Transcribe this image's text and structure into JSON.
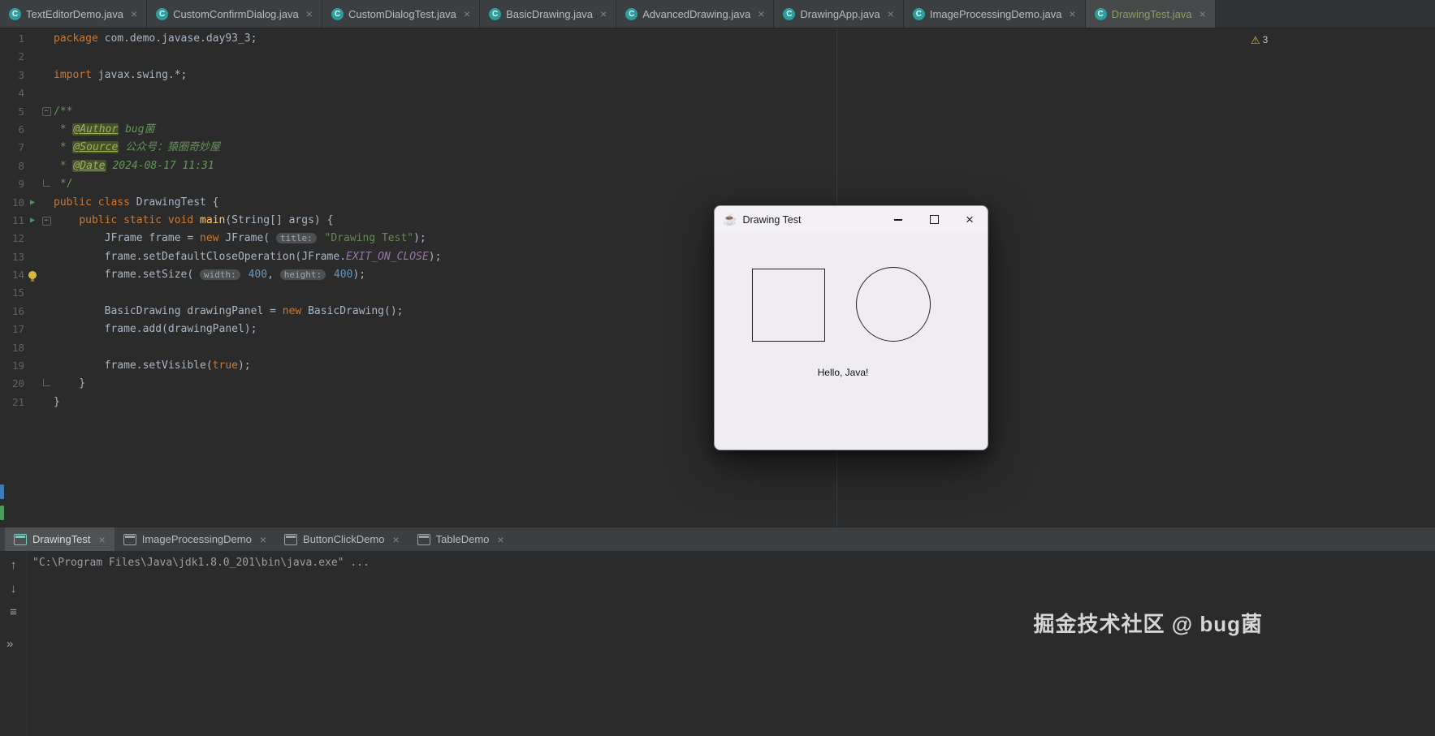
{
  "editor_tabs": {
    "icon_glyph": "C",
    "close_glyph": "×",
    "items": [
      {
        "label": "TextEditorDemo.java",
        "active": false
      },
      {
        "label": "CustomConfirmDialog.java",
        "active": false
      },
      {
        "label": "CustomDialogTest.java",
        "active": false
      },
      {
        "label": "BasicDrawing.java",
        "active": false
      },
      {
        "label": "AdvancedDrawing.java",
        "active": false
      },
      {
        "label": "DrawingApp.java",
        "active": false
      },
      {
        "label": "ImageProcessingDemo.java",
        "active": false
      },
      {
        "label": "DrawingTest.java",
        "active": true,
        "vcs": "new"
      }
    ]
  },
  "inspections": {
    "icon_glyph": "⚠",
    "count": "3"
  },
  "editor": {
    "run_glyph": "▶",
    "lines": [
      {
        "n": 1,
        "toks": [
          [
            "k",
            "package "
          ],
          [
            "p",
            "com.demo.javase.day93_3;"
          ]
        ]
      },
      {
        "n": 2,
        "toks": []
      },
      {
        "n": 3,
        "toks": [
          [
            "k",
            "import "
          ],
          [
            "p",
            "javax.swing.*;"
          ]
        ]
      },
      {
        "n": 4,
        "toks": []
      },
      {
        "n": 5,
        "fold": "open",
        "toks": [
          [
            "c",
            "/**"
          ]
        ]
      },
      {
        "n": 6,
        "toks": [
          [
            "c",
            " * "
          ],
          [
            "ct",
            "@Author"
          ],
          [
            "ci",
            " bug菌"
          ]
        ]
      },
      {
        "n": 7,
        "toks": [
          [
            "c",
            " * "
          ],
          [
            "ct",
            "@Source"
          ],
          [
            "ci",
            " 公众号：猿圈奇妙屋"
          ]
        ]
      },
      {
        "n": 8,
        "toks": [
          [
            "c",
            " * "
          ],
          [
            "ct",
            "@Date"
          ],
          [
            "ci",
            " 2024-08-17 11:31"
          ]
        ]
      },
      {
        "n": 9,
        "fold": "end",
        "toks": [
          [
            "c",
            " */"
          ]
        ]
      },
      {
        "n": 10,
        "icon": "run",
        "toks": [
          [
            "k",
            "public class "
          ],
          [
            "p",
            "DrawingTest {"
          ]
        ]
      },
      {
        "n": 11,
        "icon": "run",
        "fold": "open",
        "toks": [
          [
            "p",
            "    "
          ],
          [
            "k",
            "public static void "
          ],
          [
            "m",
            "main"
          ],
          [
            "p",
            "(String[] args) {"
          ]
        ]
      },
      {
        "n": 12,
        "toks": [
          [
            "p",
            "        JFrame frame = "
          ],
          [
            "k",
            "new "
          ],
          [
            "p",
            "JFrame( "
          ],
          [
            "hint",
            "title:"
          ],
          [
            "s",
            " \"Drawing Test\""
          ],
          [
            "p",
            ");"
          ]
        ]
      },
      {
        "n": 13,
        "toks": [
          [
            "p",
            "        frame.setDefaultCloseOperation(JFrame."
          ],
          [
            "const",
            "EXIT_ON_CLOSE"
          ],
          [
            "p",
            ");"
          ]
        ]
      },
      {
        "n": 14,
        "icon": "bulb",
        "toks": [
          [
            "p",
            "        frame.setSize( "
          ],
          [
            "hint",
            "width:"
          ],
          [
            "num",
            " 400"
          ],
          [
            "p",
            ", "
          ],
          [
            "hint",
            "height:"
          ],
          [
            "num",
            " 400"
          ],
          [
            "p",
            ");"
          ]
        ]
      },
      {
        "n": 15,
        "toks": []
      },
      {
        "n": 16,
        "toks": [
          [
            "p",
            "        BasicDrawing drawingPanel = "
          ],
          [
            "k",
            "new "
          ],
          [
            "p",
            "BasicDrawing();"
          ]
        ]
      },
      {
        "n": 17,
        "toks": [
          [
            "p",
            "        frame.add(drawingPanel);"
          ]
        ]
      },
      {
        "n": 18,
        "toks": []
      },
      {
        "n": 19,
        "toks": [
          [
            "p",
            "        frame.setVisible("
          ],
          [
            "k",
            "true"
          ],
          [
            "p",
            ");"
          ]
        ]
      },
      {
        "n": 20,
        "fold": "end",
        "toks": [
          [
            "p",
            "    }"
          ]
        ]
      },
      {
        "n": 21,
        "toks": [
          [
            "p",
            "}"
          ]
        ]
      }
    ]
  },
  "run_tabs": {
    "items": [
      {
        "label": "DrawingTest",
        "active": true
      },
      {
        "label": "ImageProcessingDemo",
        "active": false
      },
      {
        "label": "ButtonClickDemo",
        "active": false
      },
      {
        "label": "TableDemo",
        "active": false
      }
    ]
  },
  "console": {
    "line": "\"C:\\Program Files\\Java\\jdk1.8.0_201\\bin\\java.exe\" ...",
    "expander_glyph": "»",
    "toolbar": [
      {
        "name": "scroll-up-icon",
        "glyph": "↑"
      },
      {
        "name": "scroll-down-icon",
        "glyph": "↓"
      },
      {
        "name": "soft-wrap-icon",
        "glyph": "≡"
      }
    ]
  },
  "swing_window": {
    "icon_glyph": "☕",
    "title": "Drawing Test",
    "close_glyph": "×",
    "hello_text": "Hello, Java!"
  },
  "watermark": "掘金技术社区 @ bug菌",
  "colors": {
    "keyword": "#cc7832",
    "string": "#6a8759",
    "number": "#6897bb",
    "comment": "#629755",
    "constant": "#9876aa",
    "editor_bg": "#2b2b2b",
    "tabbar_bg": "#3c3f41",
    "run_green": "#499c54",
    "warning": "#e8b62c",
    "vcs_new_file": "#8ca05f"
  }
}
